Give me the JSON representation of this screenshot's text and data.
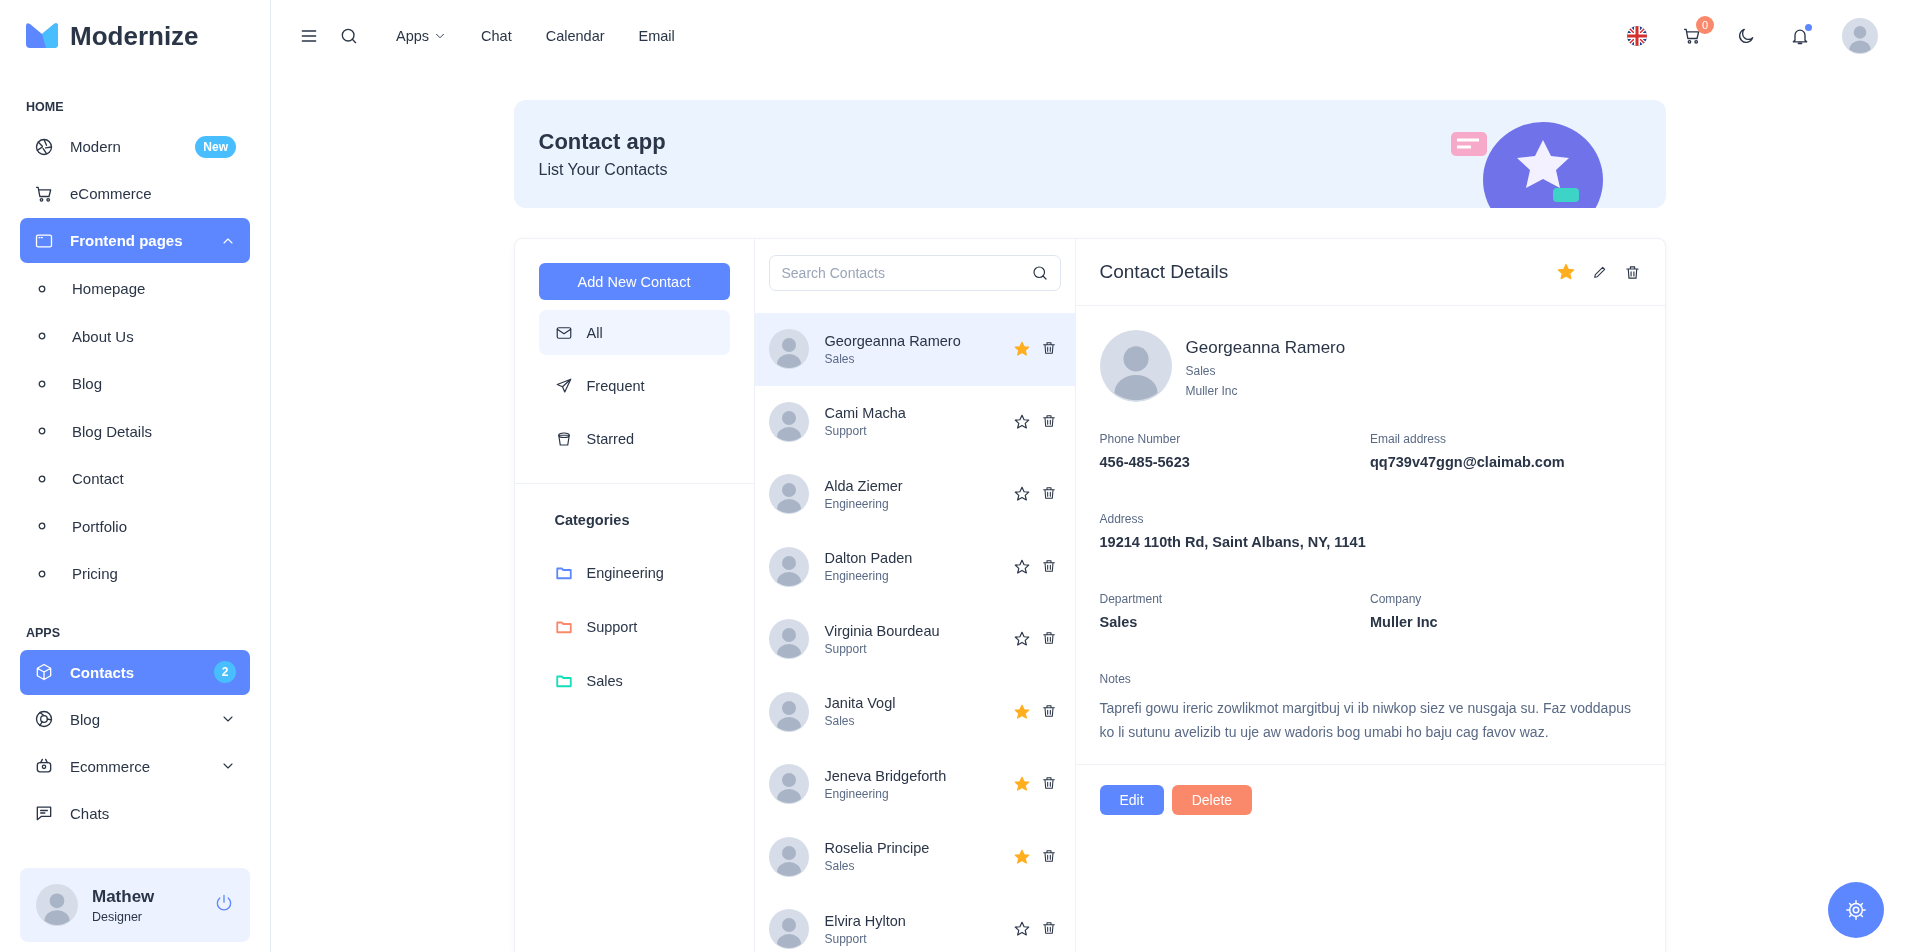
{
  "sidebar": {
    "brand": "Modernize",
    "sections": [
      {
        "title": "HOME",
        "items": [
          {
            "label": "Modern",
            "badge": "New",
            "selected": false
          },
          {
            "label": "eCommerce",
            "selected": false
          },
          {
            "label": "Frontend pages",
            "selected": true,
            "expanded": true,
            "children": [
              {
                "label": "Homepage"
              },
              {
                "label": "About Us"
              },
              {
                "label": "Blog"
              },
              {
                "label": "Blog Details"
              },
              {
                "label": "Contact"
              },
              {
                "label": "Portfolio"
              },
              {
                "label": "Pricing"
              }
            ]
          }
        ]
      },
      {
        "title": "APPS",
        "items": [
          {
            "label": "Contacts",
            "badge": "2",
            "selected": true
          },
          {
            "label": "Blog",
            "selected": false,
            "expanded": false
          },
          {
            "label": "Ecommerce",
            "selected": false,
            "expanded": false
          },
          {
            "label": "Chats",
            "selected": false
          }
        ]
      }
    ],
    "profile": {
      "name": "Mathew",
      "role": "Designer"
    }
  },
  "topbar": {
    "links": [
      {
        "label": "Apps",
        "kind": "dropdown"
      },
      {
        "label": "Chat",
        "kind": "link"
      },
      {
        "label": "Calendar",
        "kind": "link"
      },
      {
        "label": "Email",
        "kind": "link"
      }
    ],
    "cart_count": "0"
  },
  "banner": {
    "title": "Contact app",
    "subtitle": "List Your Contacts"
  },
  "filters": {
    "add_button": "Add New Contact",
    "items": [
      {
        "label": "All",
        "selected": true
      },
      {
        "label": "Frequent",
        "selected": false
      },
      {
        "label": "Starred",
        "selected": false
      }
    ],
    "categories_title": "Categories",
    "categories": [
      {
        "label": "Engineering",
        "color": "#5d87ff"
      },
      {
        "label": "Support",
        "color": "#fa896b"
      },
      {
        "label": "Sales",
        "color": "#13deb9"
      }
    ]
  },
  "contact_list": {
    "search": {
      "placeholder": "Search Contacts"
    },
    "contacts": [
      {
        "name": "Georgeanna Ramero",
        "department": "Sales",
        "starred": true,
        "selected": true
      },
      {
        "name": "Cami Macha",
        "department": "Support",
        "starred": false,
        "selected": false
      },
      {
        "name": "Alda Ziemer",
        "department": "Engineering",
        "starred": false,
        "selected": false
      },
      {
        "name": "Dalton Paden",
        "department": "Engineering",
        "starred": false,
        "selected": false
      },
      {
        "name": "Virginia Bourdeau",
        "department": "Support",
        "starred": false,
        "selected": false
      },
      {
        "name": "Janita Vogl",
        "department": "Sales",
        "starred": true,
        "selected": false
      },
      {
        "name": "Jeneva Bridgeforth",
        "department": "Engineering",
        "starred": true,
        "selected": false
      },
      {
        "name": "Roselia Principe",
        "department": "Sales",
        "starred": true,
        "selected": false
      },
      {
        "name": "Elvira Hylton",
        "department": "Support",
        "starred": false,
        "selected": false
      }
    ]
  },
  "details": {
    "title": "Contact Details",
    "starred": true,
    "name": "Georgeanna Ramero",
    "department": "Sales",
    "company": "Muller Inc",
    "rows": [
      [
        {
          "label": "Phone Number",
          "value": "456-485-5623"
        },
        {
          "label": "Email address",
          "value": "qq739v47ggn@claimab.com"
        }
      ],
      [
        {
          "label": "Address",
          "value": "19214 110th Rd, Saint Albans, NY, 1141"
        }
      ],
      [
        {
          "label": "Department",
          "value": "Sales"
        },
        {
          "label": "Company",
          "value": "Muller Inc"
        }
      ]
    ],
    "notes_label": "Notes",
    "notes": "Taprefi gowu ireric zowlikmot margitbuj vi ib niwkop siez ve nusgaja su. Faz voddapus ko li sutunu avelizib tu uje aw wadoris bog umabi ho baju cag favov waz.",
    "buttons": [
      {
        "label": "Edit",
        "kind": "primary"
      },
      {
        "label": "Delete",
        "kind": "danger"
      }
    ]
  }
}
